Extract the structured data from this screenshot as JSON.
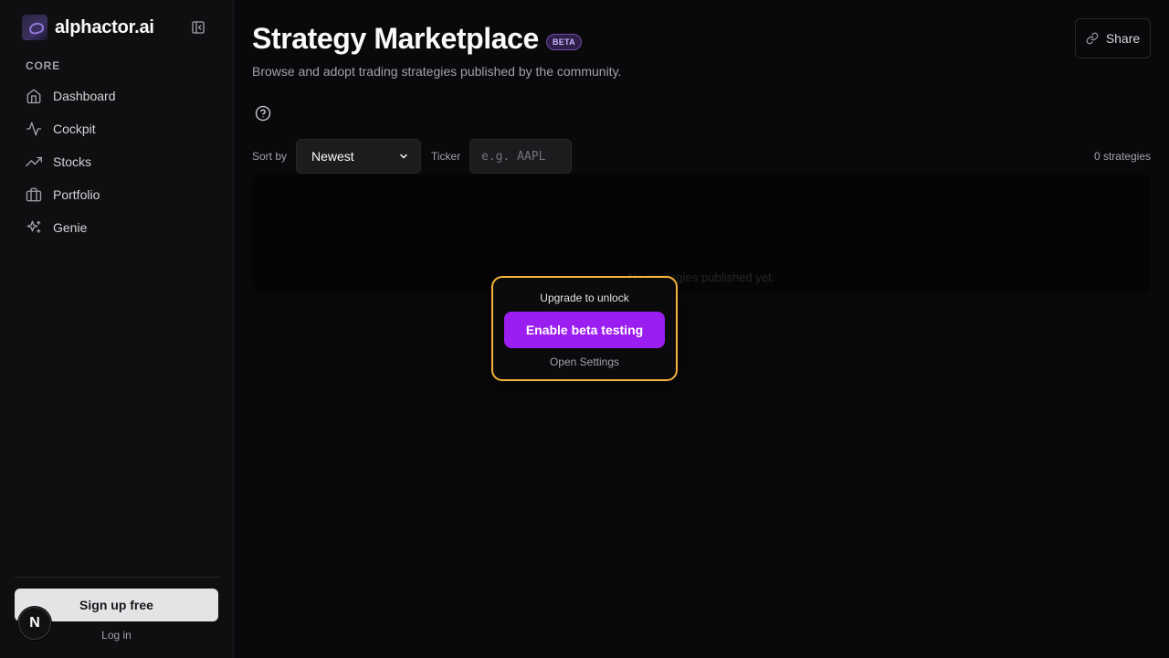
{
  "sidebar": {
    "brand": "alphactor.ai",
    "section_label": "CORE",
    "items": [
      {
        "label": "Dashboard",
        "icon": "home-icon"
      },
      {
        "label": "Cockpit",
        "icon": "activity-icon"
      },
      {
        "label": "Stocks",
        "icon": "trending-up-icon"
      },
      {
        "label": "Portfolio",
        "icon": "briefcase-icon"
      },
      {
        "label": "Genie",
        "icon": "sparkles-icon"
      }
    ],
    "signup_label": "Sign up free",
    "login_label": "Log in",
    "badge_letter": "N"
  },
  "header": {
    "title": "Strategy Marketplace",
    "badge": "BETA",
    "subtitle": "Browse and adopt trading strategies published by the community.",
    "share_label": "Share"
  },
  "filters": {
    "sort_label": "Sort by",
    "sort_value": "Newest",
    "ticker_label": "Ticker",
    "ticker_placeholder": "e.g. AAPL",
    "count": "0 strategies"
  },
  "results": {
    "empty_message": "No strategies published yet."
  },
  "lock_overlay": {
    "title": "Upgrade to unlock",
    "cta_label": "Enable beta testing",
    "settings_label": "Open Settings"
  },
  "colors": {
    "background": "#09090b",
    "sidebar": "#0f0f11",
    "accent_purple": "#9b1ef0",
    "highlight_border": "#f5b43a",
    "badge_purple": "#c4b5fd"
  }
}
